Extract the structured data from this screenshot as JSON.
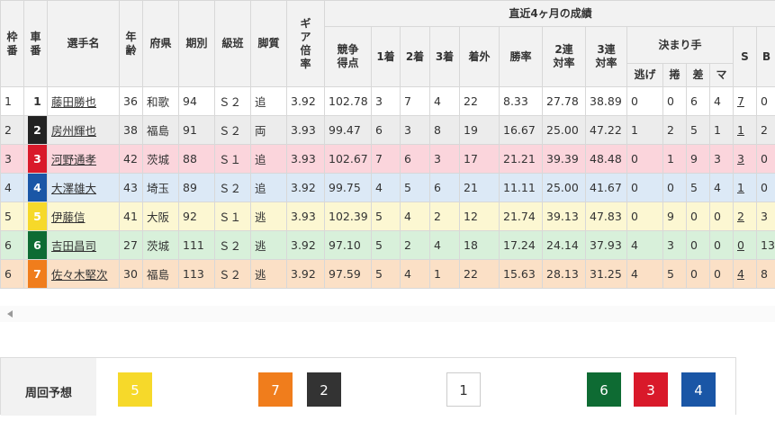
{
  "header": {
    "waku": "枠番",
    "sha": "車番",
    "name": "選手名",
    "age": "年齢",
    "pref": "府県",
    "term": "期別",
    "class": "級班",
    "style": "脚質",
    "gear": "ギア倍率",
    "recent": "直近4ヶ月の成績",
    "score": "競争得点",
    "first": "1着",
    "second": "2着",
    "third": "3着",
    "out": "着外",
    "win": "勝率",
    "ren2": "2連対率",
    "ren3": "3連対率",
    "kimarite": "決まり手",
    "nige": "逃げ",
    "makuri": "捲",
    "sashi": "差",
    "mark": "マ",
    "s": "S",
    "b": "B"
  },
  "rows": [
    {
      "waku": "1",
      "car": "1",
      "name": "藤田勝也",
      "age": "36",
      "pref": "和歌",
      "term": "94",
      "class": "Ｓ２",
      "style": "追",
      "gear": "3.92",
      "score": "102.78",
      "first": "3",
      "second": "7",
      "third": "4",
      "out": "22",
      "win": "8.33",
      "ren2": "27.78",
      "ren3": "38.89",
      "nige": "0",
      "makuri": "0",
      "sashi": "6",
      "mark": "4",
      "s": "7",
      "b": "0",
      "car_bg": "#ffffff",
      "car_fg": "#333333"
    },
    {
      "waku": "2",
      "car": "2",
      "name": "房州輝也",
      "age": "38",
      "pref": "福島",
      "term": "91",
      "class": "Ｓ２",
      "style": "両",
      "gear": "3.93",
      "score": "99.47",
      "first": "6",
      "second": "3",
      "third": "8",
      "out": "19",
      "win": "16.67",
      "ren2": "25.00",
      "ren3": "47.22",
      "nige": "1",
      "makuri": "2",
      "sashi": "5",
      "mark": "1",
      "s": "1",
      "b": "2",
      "car_bg": "#222222",
      "car_fg": "#ffffff"
    },
    {
      "waku": "3",
      "car": "3",
      "name": "河野通孝",
      "age": "42",
      "pref": "茨城",
      "term": "88",
      "class": "Ｓ１",
      "style": "追",
      "gear": "3.93",
      "score": "102.67",
      "first": "7",
      "second": "6",
      "third": "3",
      "out": "17",
      "win": "21.21",
      "ren2": "39.39",
      "ren3": "48.48",
      "nige": "0",
      "makuri": "1",
      "sashi": "9",
      "mark": "3",
      "s": "3",
      "b": "0",
      "car_bg": "#d9192a",
      "car_fg": "#ffffff"
    },
    {
      "waku": "4",
      "car": "4",
      "name": "大澤雄大",
      "age": "43",
      "pref": "埼玉",
      "term": "89",
      "class": "Ｓ２",
      "style": "追",
      "gear": "3.92",
      "score": "99.75",
      "first": "4",
      "second": "5",
      "third": "6",
      "out": "21",
      "win": "11.11",
      "ren2": "25.00",
      "ren3": "41.67",
      "nige": "0",
      "makuri": "0",
      "sashi": "5",
      "mark": "4",
      "s": "1",
      "b": "0",
      "car_bg": "#1a56a6",
      "car_fg": "#ffffff"
    },
    {
      "waku": "5",
      "car": "5",
      "name": "伊藤信",
      "age": "41",
      "pref": "大阪",
      "term": "92",
      "class": "Ｓ１",
      "style": "逃",
      "gear": "3.93",
      "score": "102.39",
      "first": "5",
      "second": "4",
      "third": "2",
      "out": "12",
      "win": "21.74",
      "ren2": "39.13",
      "ren3": "47.83",
      "nige": "0",
      "makuri": "9",
      "sashi": "0",
      "mark": "0",
      "s": "2",
      "b": "3",
      "car_bg": "#f6d92a",
      "car_fg": "#ffffff"
    },
    {
      "waku": "6",
      "car": "6",
      "name": "吉田昌司",
      "age": "27",
      "pref": "茨城",
      "term": "111",
      "class": "Ｓ２",
      "style": "逃",
      "gear": "3.92",
      "score": "97.10",
      "first": "5",
      "second": "2",
      "third": "4",
      "out": "18",
      "win": "17.24",
      "ren2": "24.14",
      "ren3": "37.93",
      "nige": "4",
      "makuri": "3",
      "sashi": "0",
      "mark": "0",
      "s": "0",
      "b": "13",
      "car_bg": "#0e6b33",
      "car_fg": "#ffffff"
    },
    {
      "waku": "6",
      "car": "7",
      "name": "佐々木堅次",
      "age": "30",
      "pref": "福島",
      "term": "113",
      "class": "Ｓ２",
      "style": "逃",
      "gear": "3.92",
      "score": "97.59",
      "first": "5",
      "second": "4",
      "third": "1",
      "out": "22",
      "win": "15.63",
      "ren2": "28.13",
      "ren3": "31.25",
      "nige": "4",
      "makuri": "5",
      "sashi": "0",
      "mark": "0",
      "s": "4",
      "b": "8",
      "car_bg": "#f07d1c",
      "car_fg": "#ffffff"
    }
  ],
  "forecast": {
    "label": "周回予想",
    "boxes": [
      {
        "num": "5",
        "bg": "#f6d92a",
        "fg": "#ffffff",
        "border": "#f6d92a"
      },
      {
        "num": "7",
        "bg": "#f07d1c",
        "fg": "#ffffff",
        "border": "#f07d1c"
      },
      {
        "num": "2",
        "bg": "#333333",
        "fg": "#ffffff",
        "border": "#333333"
      },
      {
        "num": "1",
        "bg": "#ffffff",
        "fg": "#333333",
        "border": "#cccccc"
      },
      {
        "num": "6",
        "bg": "#0e6b33",
        "fg": "#ffffff",
        "border": "#0e6b33"
      },
      {
        "num": "3",
        "bg": "#d9192a",
        "fg": "#ffffff",
        "border": "#d9192a"
      },
      {
        "num": "4",
        "bg": "#1a56a6",
        "fg": "#ffffff",
        "border": "#1a56a6"
      }
    ]
  }
}
